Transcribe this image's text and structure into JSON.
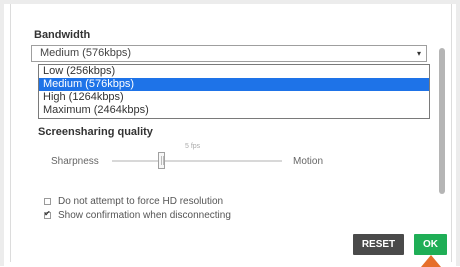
{
  "bandwidth": {
    "title": "Bandwidth",
    "selected": "Medium (576kbps)",
    "options": [
      "Low (256kbps)",
      "Medium (576kbps)",
      "High (1264kbps)",
      "Maximum (2464kbps)"
    ],
    "highlighted_index": 1
  },
  "screensharing": {
    "title": "Screensharing quality",
    "fps_label": "5 fps",
    "left_label": "Sharpness",
    "right_label": "Motion",
    "slider_value": 0.3
  },
  "checkboxes": [
    {
      "label": "Do not attempt to force HD resolution",
      "checked": false
    },
    {
      "label": "Show confirmation when disconnecting",
      "checked": true
    }
  ],
  "buttons": {
    "reset": "RESET",
    "ok": "OK"
  },
  "colors": {
    "highlight": "#1e73e8",
    "ok": "#1fae56",
    "reset": "#4a4a4a",
    "pointer": "#e66f2b"
  }
}
